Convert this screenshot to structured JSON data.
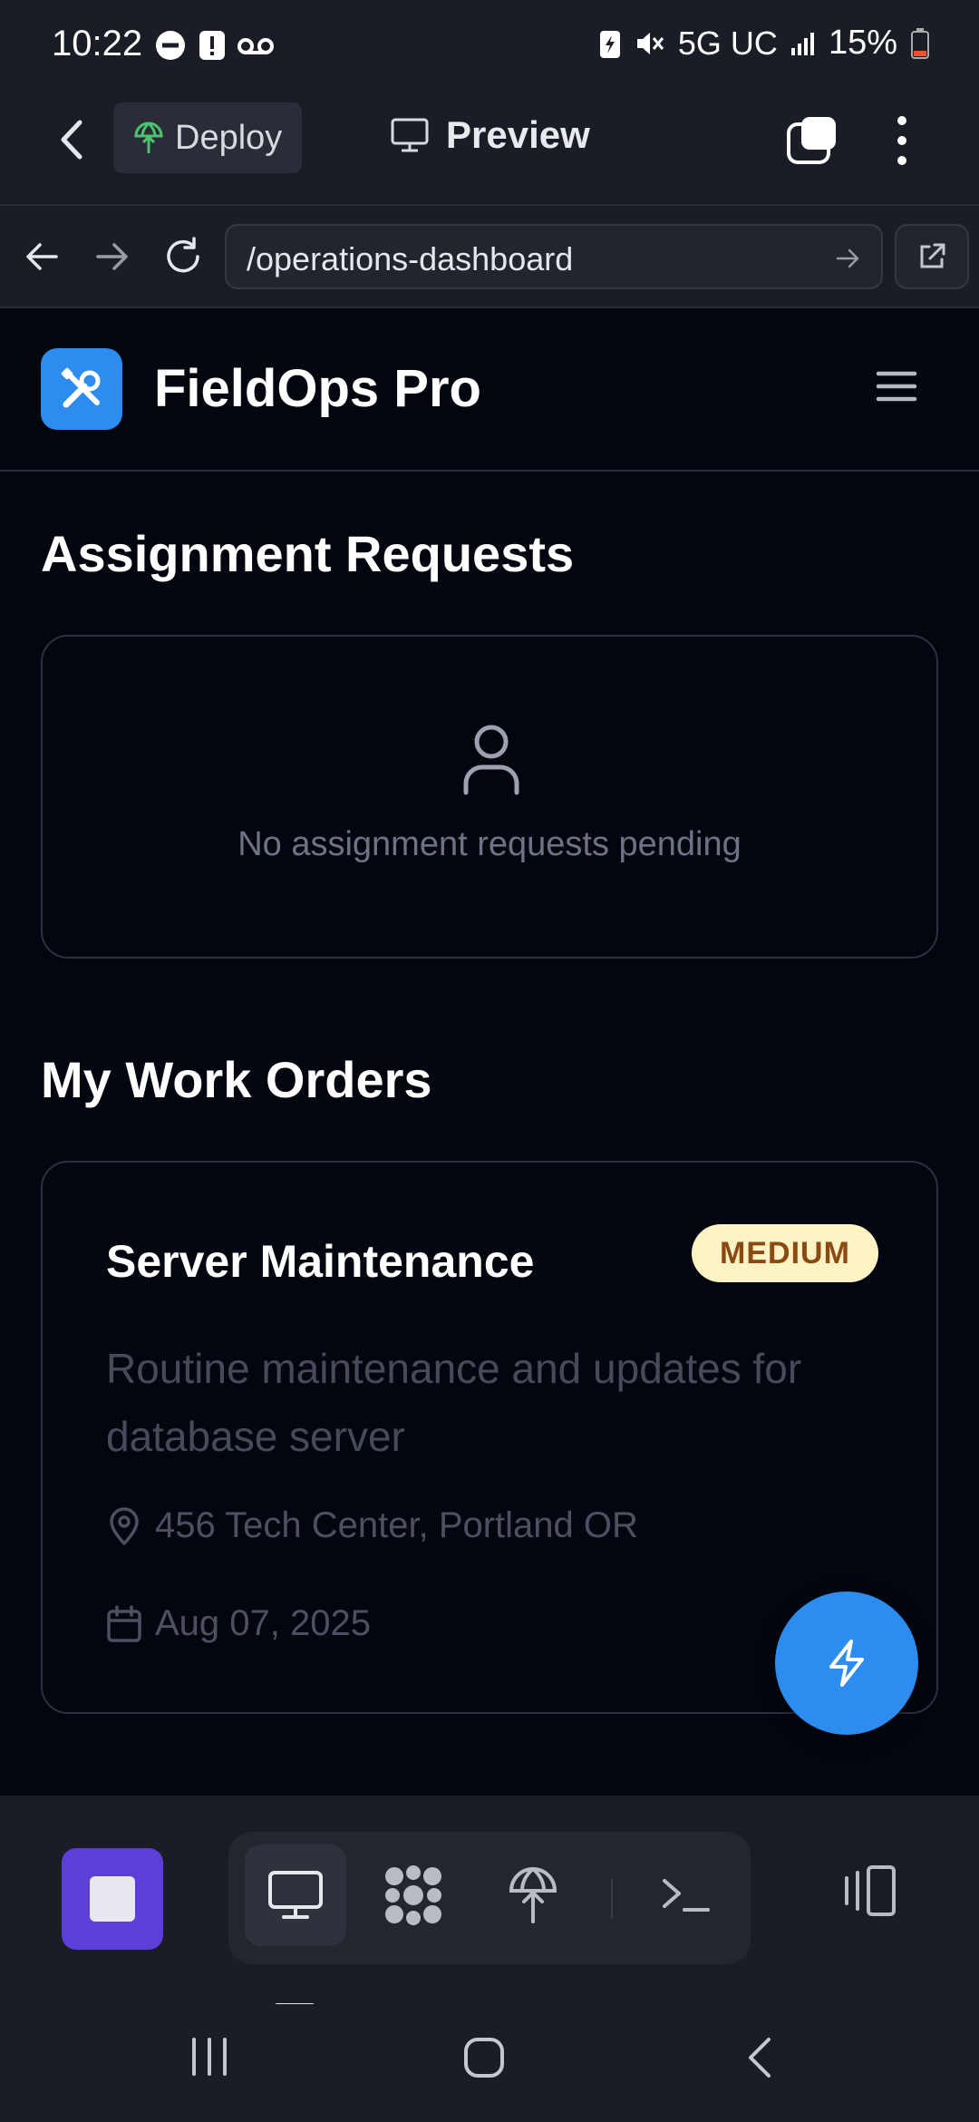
{
  "status_bar": {
    "time": "10:22",
    "network": "5G UC",
    "battery": "15%"
  },
  "app_bar": {
    "deploy_label": "Deploy",
    "preview_label": "Preview"
  },
  "url_bar": {
    "url": "/operations-dashboard"
  },
  "app": {
    "name": "FieldOps Pro"
  },
  "assignment_requests": {
    "title": "Assignment Requests",
    "empty_text": "No assignment requests pending"
  },
  "work_orders": {
    "title": "My Work Orders",
    "items": [
      {
        "title": "Server Maintenance",
        "priority": "MEDIUM",
        "description": "Routine maintenance and updates for database server",
        "location": "456 Tech Center, Portland OR",
        "date": "Aug 07, 2025"
      }
    ]
  },
  "colors": {
    "accent": "#2d8cf0",
    "badge_bg": "#fdf3c4",
    "badge_text": "#8a4a12",
    "stop_button": "#5b3fd6"
  }
}
